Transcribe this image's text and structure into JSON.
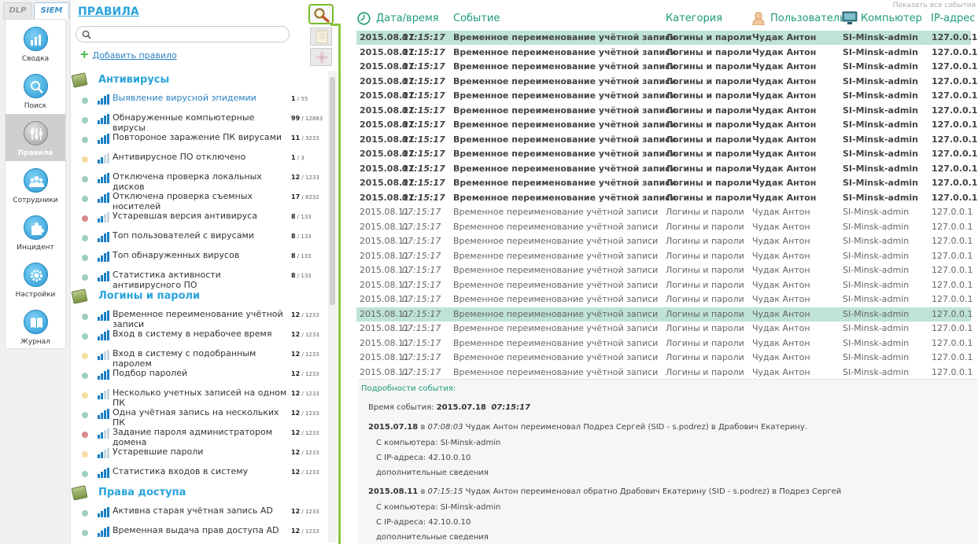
{
  "nav": {
    "tabs": [
      {
        "label": "DLP"
      },
      {
        "label": "SIEM"
      }
    ],
    "items": [
      {
        "label": "Сводка",
        "icon": "bar-chart-icon"
      },
      {
        "label": "Поиск",
        "icon": "magnifier-icon"
      },
      {
        "label": "Правила",
        "icon": "sliders-icon",
        "active": true
      },
      {
        "label": "Сотрудники",
        "icon": "people-icon"
      },
      {
        "label": "Инцидент",
        "icon": "puzzle-icon"
      },
      {
        "label": "Настройки",
        "icon": "gear-icon"
      },
      {
        "label": "Журнал",
        "icon": "book-icon"
      }
    ]
  },
  "rules": {
    "title": "ПРАВИЛА",
    "search_placeholder": "",
    "add_label": "Добавить правило",
    "groups": [
      {
        "title": "Антивирусы",
        "rules": [
          {
            "name": "Выявление вирусной эпидемии",
            "count": "1",
            "total": "55",
            "status": "green",
            "link": true
          },
          {
            "name": "Обнаруженные компьютерные вирусы",
            "count": "99",
            "total": "12883",
            "status": "green"
          },
          {
            "name": "Повтороное заражение ПК вирусами",
            "count": "11",
            "total": "3233",
            "status": "green"
          },
          {
            "name": "Антивирусное ПО отключено",
            "count": "1",
            "total": "3",
            "status": "yellow"
          },
          {
            "name": "Отключена проверка локальных дисков",
            "count": "12",
            "total": "1233",
            "status": "green"
          },
          {
            "name": "Отключена проверка съемных носителей",
            "count": "17",
            "total": "6232",
            "status": "green"
          },
          {
            "name": "Устаревшая версия антивируса",
            "count": "8",
            "total": "133",
            "status": "red"
          },
          {
            "name": "Топ пользователей с вирусами",
            "count": "8",
            "total": "133",
            "status": "green"
          },
          {
            "name": "Топ обнаруженных вирусов",
            "count": "8",
            "total": "133",
            "status": "green"
          },
          {
            "name": "Статистика активности антивирусного ПО",
            "count": "8",
            "total": "133",
            "status": "green"
          }
        ]
      },
      {
        "title": "Логины и пароли",
        "rules": [
          {
            "name": "Временное переименование учётной записи",
            "count": "12",
            "total": "1233",
            "status": "green"
          },
          {
            "name": "Вход в систему в нерабочее время",
            "count": "12",
            "total": "1233",
            "status": "green"
          },
          {
            "name": "Вход в систему с подобранным паролем",
            "count": "12",
            "total": "1233",
            "status": "yellow"
          },
          {
            "name": "Подбор паролей",
            "count": "12",
            "total": "1233",
            "status": "green"
          },
          {
            "name": "Несколько учетных записей на одном ПК",
            "count": "12",
            "total": "1233",
            "status": "yellow"
          },
          {
            "name": "Одна учётная запись на нескольких ПК",
            "count": "12",
            "total": "1233",
            "status": "green"
          },
          {
            "name": "Задание пароля администратором домена",
            "count": "12",
            "total": "1233",
            "status": "red"
          },
          {
            "name": "Устаревшие пароли",
            "count": "12",
            "total": "1233",
            "status": "yellow"
          },
          {
            "name": "Статистика входов в систему",
            "count": "12",
            "total": "1233",
            "status": "green"
          }
        ]
      },
      {
        "title": "Права доступа",
        "rules": [
          {
            "name": "Активна старая учётная запись AD",
            "count": "12",
            "total": "1233",
            "status": "green"
          },
          {
            "name": "Временная выдача прав доступа AD",
            "count": "12",
            "total": "1233",
            "status": "green"
          }
        ]
      }
    ]
  },
  "events": {
    "show_all": "Показать все события",
    "columns": {
      "datetime": "Дата/время",
      "event": "Событие",
      "category": "Категория",
      "user": "Пользователь",
      "computer": "Компьютер",
      "ip": "IP-адрес"
    },
    "rows": [
      {
        "date": "2015.08.11",
        "time": "07:15:17",
        "event": "Временное переименование учётной записи",
        "category": "Логины и пароли",
        "user": "Чудак Антон",
        "computer": "SI-Minsk-admin",
        "ip": "127.0.0.1",
        "bold": true,
        "selected": true
      },
      {
        "date": "2015.08.11",
        "time": "07:15:17",
        "event": "Временное переименование учётной записи",
        "category": "Логины и пароли",
        "user": "Чудак Антон",
        "computer": "SI-Minsk-admin",
        "ip": "127.0.0.1",
        "bold": true
      },
      {
        "date": "2015.08.11",
        "time": "07:15:17",
        "event": "Временное переименование учётной записи",
        "category": "Логины и пароли",
        "user": "Чудак Антон",
        "computer": "SI-Minsk-admin",
        "ip": "127.0.0.1",
        "bold": true
      },
      {
        "date": "2015.08.11",
        "time": "07:15:17",
        "event": "Временное переименование учётной записи",
        "category": "Логины и пароли",
        "user": "Чудак Антон",
        "computer": "SI-Minsk-admin",
        "ip": "127.0.0.1",
        "bold": true
      },
      {
        "date": "2015.08.11",
        "time": "07:15:17",
        "event": "Временное переименование учётной записи",
        "category": "Логины и пароли",
        "user": "Чудак Антон",
        "computer": "SI-Minsk-admin",
        "ip": "127.0.0.1",
        "bold": true
      },
      {
        "date": "2015.08.11",
        "time": "07:15:17",
        "event": "Временное переименование учётной записи",
        "category": "Логины и пароли",
        "user": "Чудак Антон",
        "computer": "SI-Minsk-admin",
        "ip": "127.0.0.1",
        "bold": true
      },
      {
        "date": "2015.08.11",
        "time": "07:15:17",
        "event": "Временное переименование учётной записи",
        "category": "Логины и пароли",
        "user": "Чудак Антон",
        "computer": "SI-Minsk-admin",
        "ip": "127.0.0.1",
        "bold": true
      },
      {
        "date": "2015.08.11",
        "time": "07:15:17",
        "event": "Временное переименование учётной записи",
        "category": "Логины и пароли",
        "user": "Чудак Антон",
        "computer": "SI-Minsk-admin",
        "ip": "127.0.0.1",
        "bold": true
      },
      {
        "date": "2015.08.11",
        "time": "07:15:17",
        "event": "Временное переименование учётной записи",
        "category": "Логины и пароли",
        "user": "Чудак Антон",
        "computer": "SI-Minsk-admin",
        "ip": "127.0.0.1",
        "bold": true
      },
      {
        "date": "2015.08.11",
        "time": "07:15:17",
        "event": "Временное переименование учётной записи",
        "category": "Логины и пароли",
        "user": "Чудак Антон",
        "computer": "SI-Minsk-admin",
        "ip": "127.0.0.1",
        "bold": true
      },
      {
        "date": "2015.08.11",
        "time": "07:15:17",
        "event": "Временное переименование учётной записи",
        "category": "Логины и пароли",
        "user": "Чудак Антон",
        "computer": "SI-Minsk-admin",
        "ip": "127.0.0.1",
        "bold": true
      },
      {
        "date": "2015.08.11",
        "time": "07:15:17",
        "event": "Временное переименование учётной записи",
        "category": "Логины и пароли",
        "user": "Чудак Антон",
        "computer": "SI-Minsk-admin",
        "ip": "127.0.0.1",
        "bold": true
      },
      {
        "date": "2015.08.11",
        "time": "07:15:17",
        "event": "Временное переименование учётной записи",
        "category": "Логины и пароли",
        "user": "Чудак Антон",
        "computer": "SI-Minsk-admin",
        "ip": "127.0.0.1"
      },
      {
        "date": "2015.08.11",
        "time": "07:15:17",
        "event": "Временное переименование учётной записи",
        "category": "Логины и пароли",
        "user": "Чудак Антон",
        "computer": "SI-Minsk-admin",
        "ip": "127.0.0.1"
      },
      {
        "date": "2015.08.11",
        "time": "07:15:17",
        "event": "Временное переименование учётной записи",
        "category": "Логины и пароли",
        "user": "Чудак Антон",
        "computer": "SI-Minsk-admin",
        "ip": "127.0.0.1"
      },
      {
        "date": "2015.08.11",
        "time": "07:15:17",
        "event": "Временное переименование учётной записи",
        "category": "Логины и пароли",
        "user": "Чудак Антон",
        "computer": "SI-Minsk-admin",
        "ip": "127.0.0.1"
      },
      {
        "date": "2015.08.11",
        "time": "07:15:17",
        "event": "Временное переименование учётной записи",
        "category": "Логины и пароли",
        "user": "Чудак Антон",
        "computer": "SI-Minsk-admin",
        "ip": "127.0.0.1"
      },
      {
        "date": "2015.08.11",
        "time": "07:15:17",
        "event": "Временное переименование учётной записи",
        "category": "Логины и пароли",
        "user": "Чудак Антон",
        "computer": "SI-Minsk-admin",
        "ip": "127.0.0.1"
      },
      {
        "date": "2015.08.11",
        "time": "07:15:17",
        "event": "Временное переименование учётной записи",
        "category": "Логины и пароли",
        "user": "Чудак Антон",
        "computer": "SI-Minsk-admin",
        "ip": "127.0.0.1"
      },
      {
        "date": "2015.08.11",
        "time": "07:15:17",
        "event": "Временное переименование учётной записи",
        "category": "Логины и пароли",
        "user": "Чудак Антон",
        "computer": "SI-Minsk-admin",
        "ip": "127.0.0.1",
        "selected": true
      },
      {
        "date": "2015.08.11",
        "time": "07:15:17",
        "event": "Временное переименование учётной записи",
        "category": "Логины и пароли",
        "user": "Чудак Антон",
        "computer": "SI-Minsk-admin",
        "ip": "127.0.0.1"
      },
      {
        "date": "2015.08.11",
        "time": "07:15:17",
        "event": "Временное переименование учётной записи",
        "category": "Логины и пароли",
        "user": "Чудак Антон",
        "computer": "SI-Minsk-admin",
        "ip": "127.0.0.1"
      },
      {
        "date": "2015.08.11",
        "time": "07:15:17",
        "event": "Временное переименование учётной записи",
        "category": "Логины и пароли",
        "user": "Чудак Антон",
        "computer": "SI-Minsk-admin",
        "ip": "127.0.0.1"
      },
      {
        "date": "2015.08.11",
        "time": "07:15:17",
        "event": "Временное переименование учётной записи",
        "category": "Логины и пароли",
        "user": "Чудак Антон",
        "computer": "SI-Minsk-admin",
        "ip": "127.0.0.1"
      }
    ]
  },
  "details": {
    "title": "Подробности события:",
    "time_label": "Время события:",
    "time_date": "2015.07.18",
    "time_time": "07:15:17",
    "entries": [
      {
        "date": "2015.07.18",
        "in": "в",
        "time": "07:08:03",
        "text": "Чудак Антон переименовал Подрез Сергей (SID - s.podrez) в Драбович Екатерину.",
        "computer": "С компьютера: SI-Minsk-admin",
        "ip": "С IP-адреса: 42.10.0.10",
        "more": "дополнительные сведения"
      },
      {
        "date": "2015.08.11",
        "in": "в",
        "time": "07:15:15",
        "text": "Чудак Антон переименовал обратно Драбович Екатерину (SID - s.podrez) в Подрез Сергей",
        "computer": "С компьютера: SI-Minsk-admin",
        "ip": "С IP-адреса: 42.10.0.10",
        "more": "дополнительные сведения"
      }
    ]
  },
  "colors": {
    "accent": "#2aa4dc",
    "header": "#1e9a7a",
    "selected": "#bfe3d6",
    "divider": "#8cc43f",
    "dot_green": "#9ecfbf",
    "dot_yellow": "#f5dca0",
    "dot_red": "#d98a8a"
  }
}
